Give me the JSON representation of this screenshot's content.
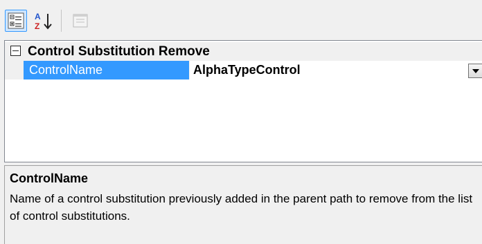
{
  "toolbar": {
    "buttons": [
      {
        "icon": "categorized-icon",
        "state": "pressed"
      },
      {
        "icon": "alphabetical-sort-icon",
        "state": "normal"
      },
      {
        "icon": "property-pages-icon",
        "state": "disabled"
      }
    ]
  },
  "grid": {
    "category": {
      "label": "Control Substitution Remove",
      "expanded": true
    },
    "property": {
      "name": "ControlName",
      "value": "AlphaTypeControl",
      "selected": true
    }
  },
  "description": {
    "title": "ControlName",
    "text": "Name of a control substitution previously added in the parent path to remove from the list of control substitutions."
  },
  "colors": {
    "selection": "#3399ff",
    "background": "#f0f0f0",
    "grid_bg": "#ffffff"
  }
}
